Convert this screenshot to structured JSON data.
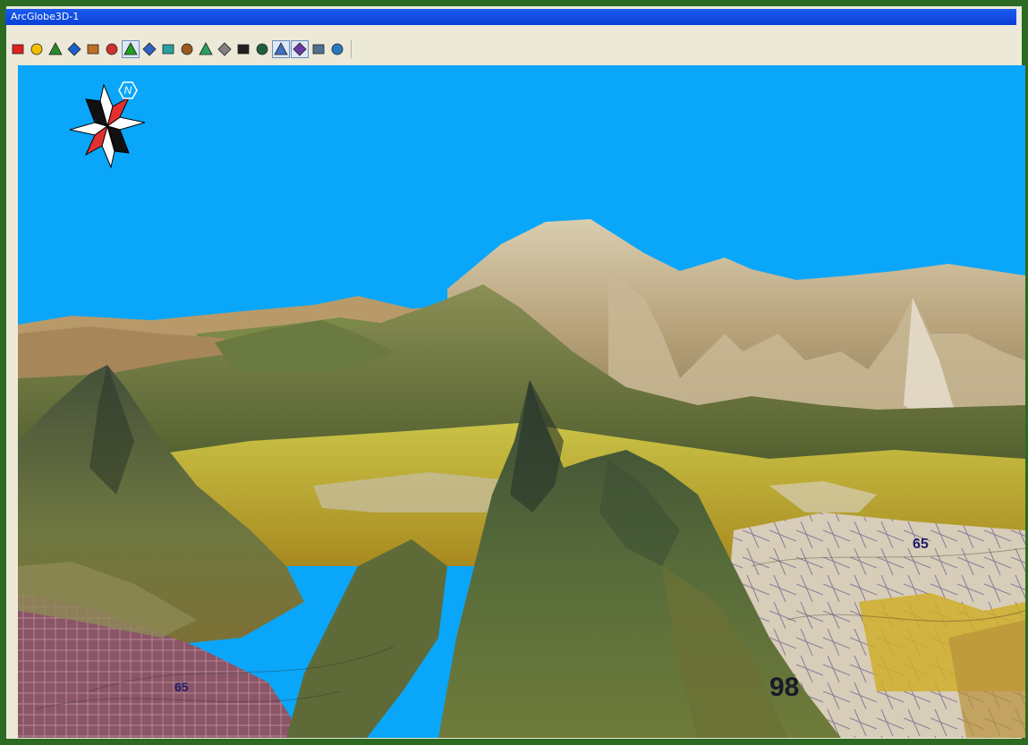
{
  "window": {
    "title": "ArcGlobe3D-1"
  },
  "toolbar": {
    "tools": [
      {
        "icon": "add-layer-red-icon",
        "pressed": false
      },
      {
        "icon": "add-layer-yellow-icon",
        "pressed": false
      },
      {
        "icon": "layer-properties-icon",
        "pressed": false
      },
      {
        "icon": "hud-icon",
        "pressed": false
      },
      {
        "icon": "add-data-icon",
        "pressed": false
      },
      {
        "icon": "remove-layer-icon",
        "pressed": false
      },
      {
        "icon": "select-feature-icon",
        "pressed": true
      },
      {
        "icon": "clear-selection-icon",
        "pressed": false
      },
      {
        "icon": "identify-icon",
        "pressed": false
      },
      {
        "icon": "elevation-icon",
        "pressed": false
      },
      {
        "icon": "exaggeration-icon",
        "pressed": false
      },
      {
        "icon": "full-extent-icon",
        "pressed": false
      },
      {
        "icon": "observer-icon",
        "pressed": false
      },
      {
        "icon": "target-icon",
        "pressed": false
      },
      {
        "icon": "navigate-icon",
        "pressed": true
      },
      {
        "icon": "fly-icon",
        "pressed": true
      },
      {
        "icon": "zoom-to-target-icon",
        "pressed": false
      },
      {
        "icon": "globe-icon",
        "pressed": false
      }
    ]
  },
  "viewport": {
    "sky_color": "#0aa6f9",
    "compass_label": "N",
    "map_labels": [
      "65",
      "98",
      "65"
    ]
  }
}
